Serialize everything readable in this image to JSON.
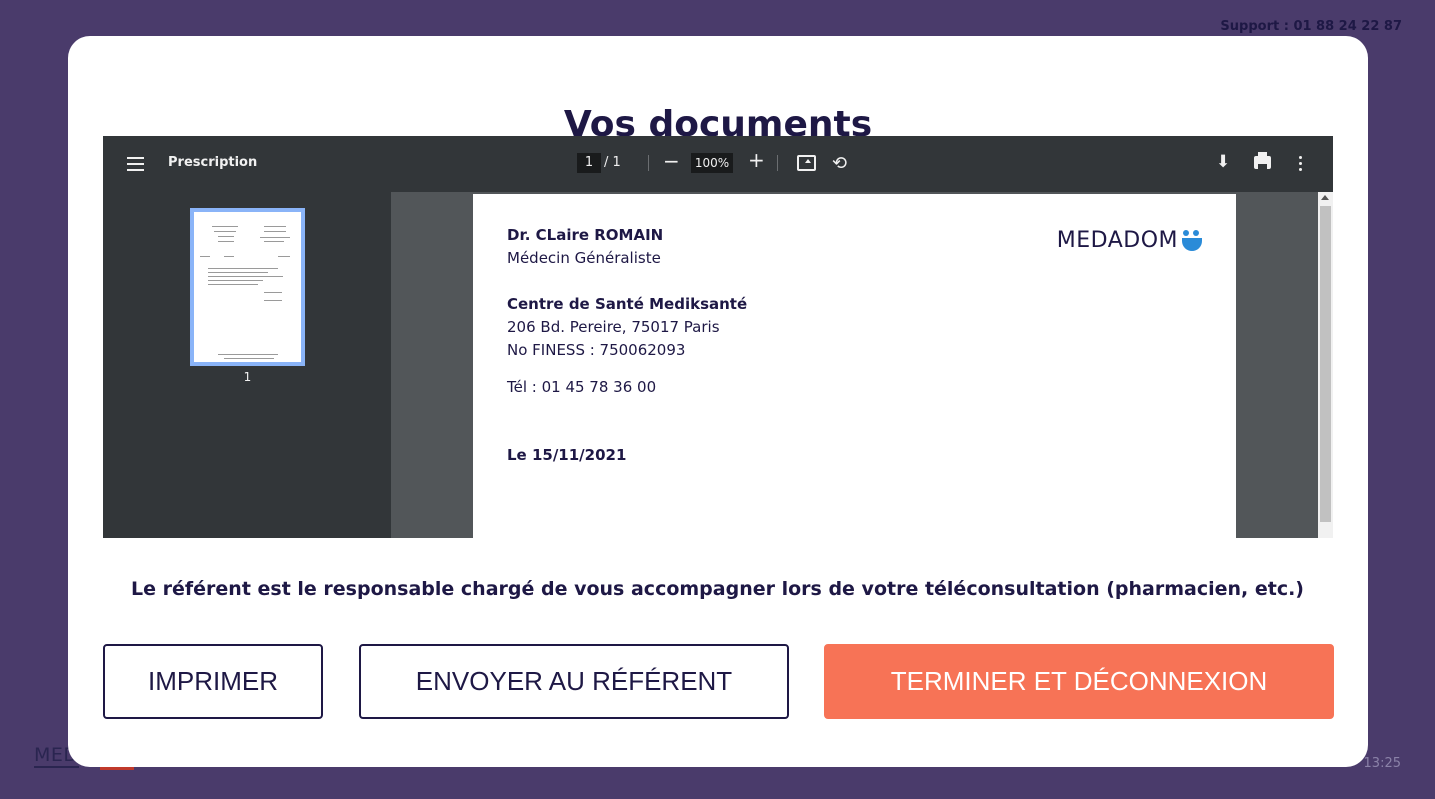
{
  "support": "Support : 01 88 24 22 87",
  "background": {
    "logo_fragment": "MED",
    "time": "13:25"
  },
  "modal": {
    "title": "Vos documents"
  },
  "pdf": {
    "title": "Prescription",
    "page_current": "1",
    "page_total": "/  1",
    "zoom": "100%",
    "thumb_number": "1",
    "document": {
      "doctor": "Dr. CLaire ROMAIN",
      "specialty": "Médecin Généraliste",
      "center": "Centre de Santé Mediksanté",
      "address": "206 Bd. Pereire, 75017 Paris",
      "finess": "No FINESS : 750062093",
      "phone": "Tél : 01 45 78 36 00",
      "date": "Le 15/11/2021",
      "brand": "MEDADOM"
    }
  },
  "info": "Le référent est le responsable chargé de vous accompagner lors de votre téléconsultation (pharmacien, etc.)",
  "buttons": {
    "print": "IMPRIMER",
    "send": "ENVOYER AU RÉFÉRENT",
    "end": "TERMINER ET DÉCONNEXION"
  },
  "colors": {
    "background": "#4a3b6b",
    "primary_text": "#1e1845",
    "accent": "#f77356",
    "pdf_toolbar": "#323639",
    "thumb_highlight": "#8ab4f8"
  }
}
